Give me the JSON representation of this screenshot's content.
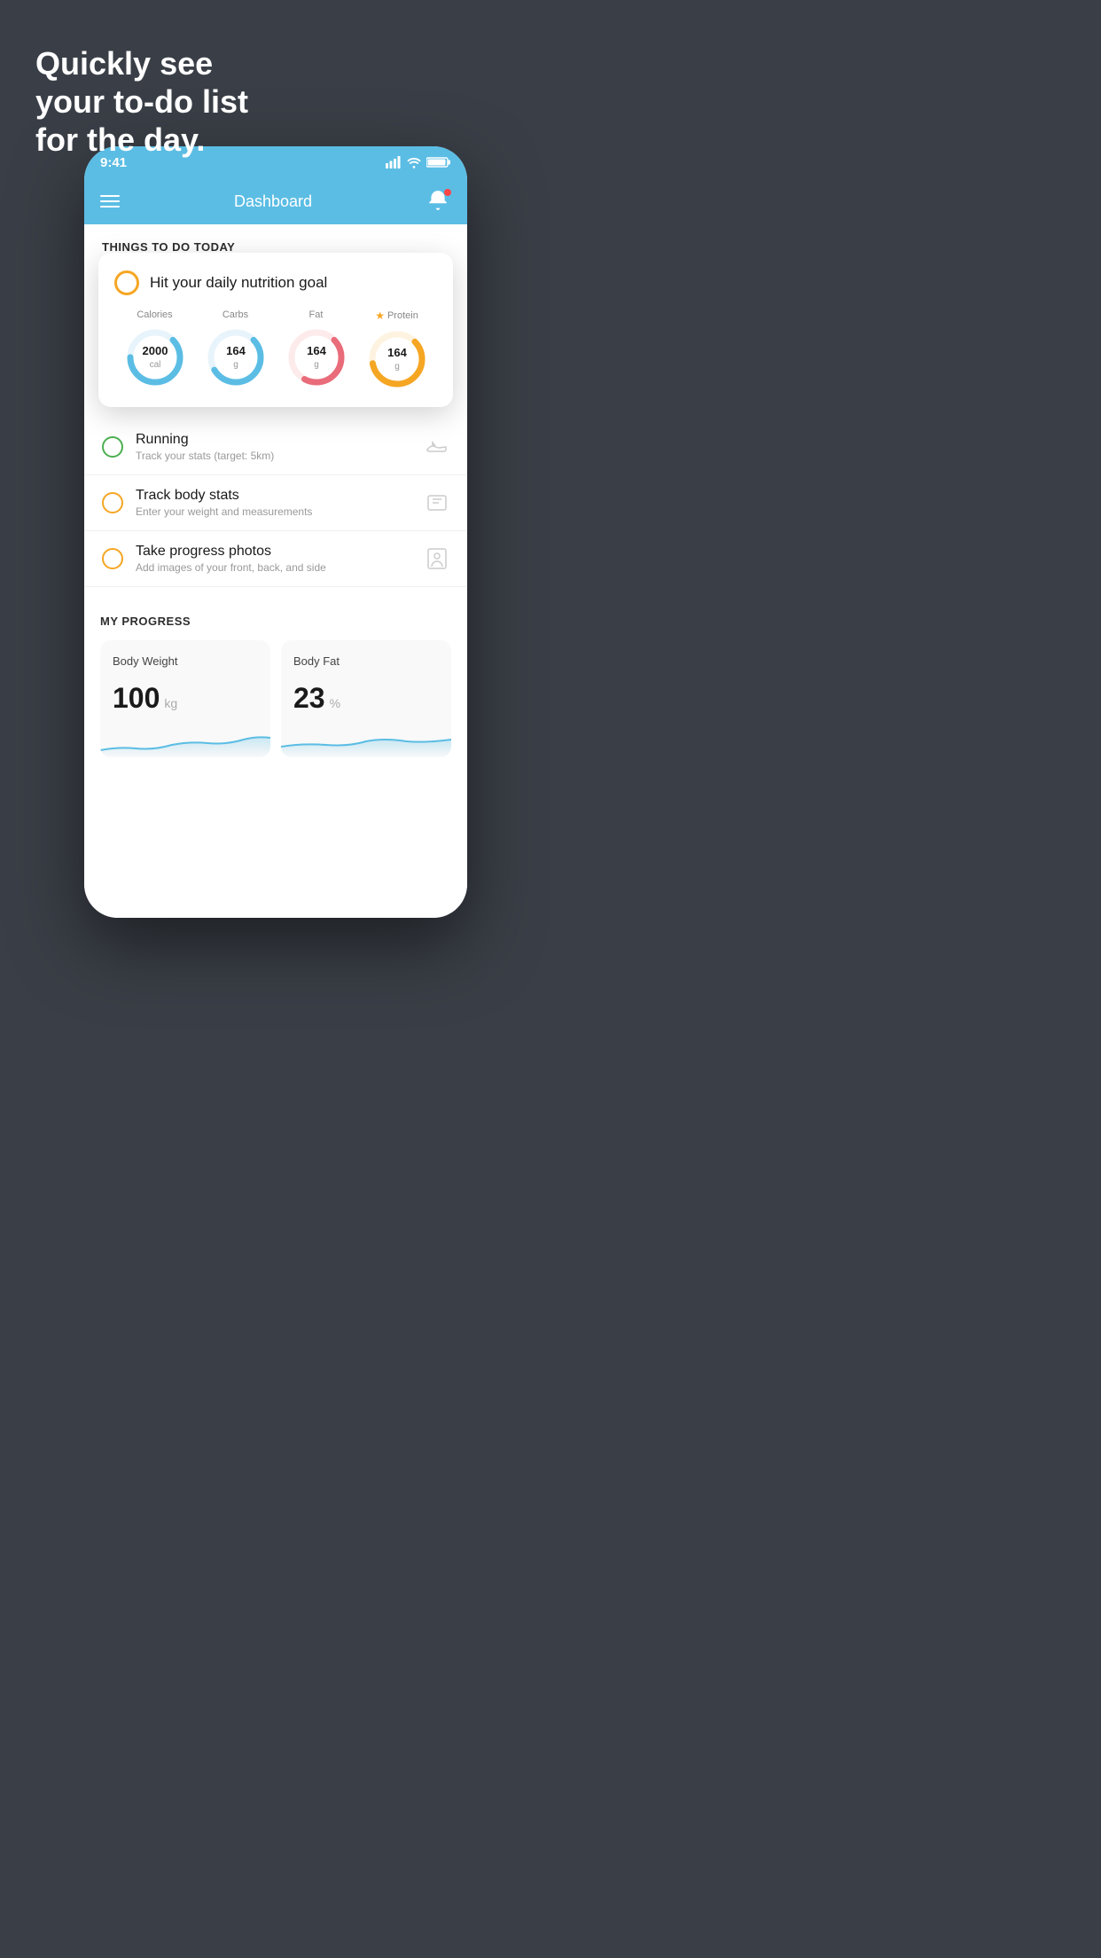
{
  "hero": {
    "line1": "Quickly see",
    "line2": "your to-do list",
    "line3": "for the day."
  },
  "status_bar": {
    "time": "9:41",
    "signal": "▌▌▌▌",
    "wifi": "wifi",
    "battery": "battery"
  },
  "nav": {
    "title": "Dashboard"
  },
  "things_today": {
    "header": "THINGS TO DO TODAY"
  },
  "nutrition_card": {
    "title": "Hit your daily nutrition goal",
    "calories": {
      "label": "Calories",
      "value": "2000",
      "unit": "cal"
    },
    "carbs": {
      "label": "Carbs",
      "value": "164",
      "unit": "g"
    },
    "fat": {
      "label": "Fat",
      "value": "164",
      "unit": "g"
    },
    "protein": {
      "label": "Protein",
      "value": "164",
      "unit": "g"
    }
  },
  "todo_items": [
    {
      "title": "Running",
      "subtitle": "Track your stats (target: 5km)",
      "circle": "green",
      "icon": "shoe"
    },
    {
      "title": "Track body stats",
      "subtitle": "Enter your weight and measurements",
      "circle": "yellow",
      "icon": "scale"
    },
    {
      "title": "Take progress photos",
      "subtitle": "Add images of your front, back, and side",
      "circle": "yellow",
      "icon": "person"
    }
  ],
  "progress": {
    "header": "MY PROGRESS",
    "body_weight": {
      "title": "Body Weight",
      "value": "100",
      "unit": "kg"
    },
    "body_fat": {
      "title": "Body Fat",
      "value": "23",
      "unit": "%"
    }
  }
}
